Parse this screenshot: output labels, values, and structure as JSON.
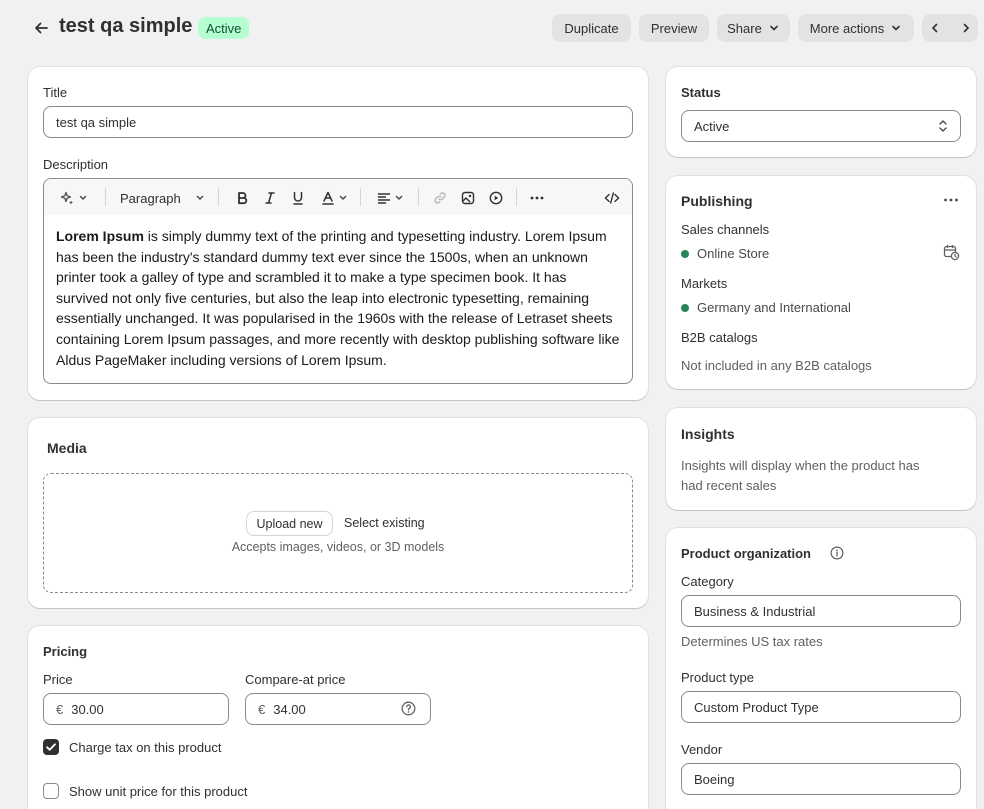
{
  "header": {
    "title": "test qa simple",
    "status_badge": "Active",
    "actions": {
      "duplicate": "Duplicate",
      "preview": "Preview",
      "share": "Share",
      "more_actions": "More actions"
    }
  },
  "product_card": {
    "title_label": "Title",
    "title_value": "test qa simple",
    "description_label": "Description",
    "toolbar": {
      "paragraph": "Paragraph"
    },
    "description_bold": "Lorem Ipsum",
    "description_lines": [
      " is simply dummy text of the printing and typesetting industry. Lorem Ipsum",
      "has been the industry's standard dummy text ever since the 1500s, when an unknown",
      "printer took a galley of type and scrambled it to make a type specimen book. It has",
      "survived not only five centuries, but also the leap into electronic typesetting, remaining",
      "essentially unchanged. It was popularised in the 1960s with the release of Letraset sheets",
      "containing Lorem Ipsum passages, and more recently with desktop publishing software like",
      "Aldus PageMaker including versions of Lorem Ipsum."
    ]
  },
  "media": {
    "heading": "Media",
    "upload_new": "Upload new",
    "select_existing": "Select existing",
    "hint": "Accepts images, videos, or 3D models"
  },
  "pricing": {
    "heading": "Pricing",
    "price_label": "Price",
    "currency": "€",
    "price_value": "30.00",
    "compare_label": "Compare-at price",
    "compare_value": "34.00",
    "charge_tax_label": "Charge tax on this product",
    "charge_tax_checked": true,
    "unit_price_label": "Show unit price for this product",
    "unit_price_checked": false
  },
  "status_card": {
    "heading": "Status",
    "value": "Active"
  },
  "publishing": {
    "heading": "Publishing",
    "sales_channels_label": "Sales channels",
    "sales_channel": "Online Store",
    "markets_label": "Markets",
    "market": "Germany and International",
    "b2b_label": "B2B catalogs",
    "b2b_value": "Not included in any B2B catalogs"
  },
  "insights": {
    "heading": "Insights",
    "text_line1": "Insights will display when the product has",
    "text_line2": "had recent sales"
  },
  "organization": {
    "heading": "Product organization",
    "category_label": "Category",
    "category_value": "Business & Industrial",
    "category_hint": "Determines US tax rates",
    "type_label": "Product type",
    "type_value": "Custom Product Type",
    "vendor_label": "Vendor",
    "vendor_value": "Boeing"
  },
  "colors": {
    "badge_bg": "#b4fed2",
    "badge_text": "#0c5132",
    "status_dot": "#29845a",
    "checkbox": "#303030"
  }
}
